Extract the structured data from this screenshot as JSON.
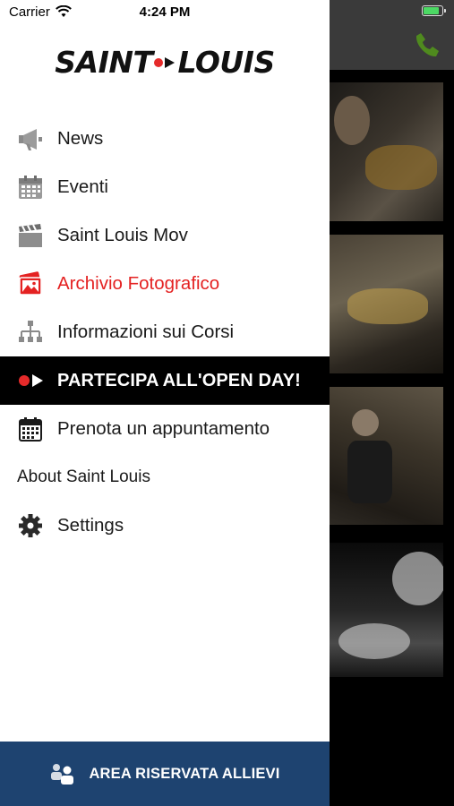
{
  "status_bar": {
    "carrier": "Carrier",
    "time": "4:24 PM"
  },
  "logo": {
    "left": "SAINT",
    "right": "LOUIS"
  },
  "menu": {
    "items": [
      {
        "label": "News",
        "icon": "megaphone-icon"
      },
      {
        "label": "Eventi",
        "icon": "calendar-icon"
      },
      {
        "label": "Saint Louis Mov",
        "icon": "clapperboard-icon"
      },
      {
        "label": "Archivio Fotografico",
        "icon": "photo-gallery-icon"
      },
      {
        "label": "Informazioni sui Corsi",
        "icon": "sitemap-icon"
      },
      {
        "label": "PARTECIPA ALL'OPEN DAY!",
        "icon": "record-play-icon"
      },
      {
        "label": "Prenota un appuntamento",
        "icon": "calendar-grid-icon"
      },
      {
        "label": "About Saint Louis"
      },
      {
        "label": "Settings",
        "icon": "gear-icon"
      }
    ]
  },
  "bottom_bar": {
    "label": "AREA RISERVATA ALLIEVI",
    "icon": "users-icon"
  },
  "colors": {
    "accent_red": "#e42222",
    "bar_blue": "#1e4370",
    "phone_green": "#4f8a1e"
  }
}
